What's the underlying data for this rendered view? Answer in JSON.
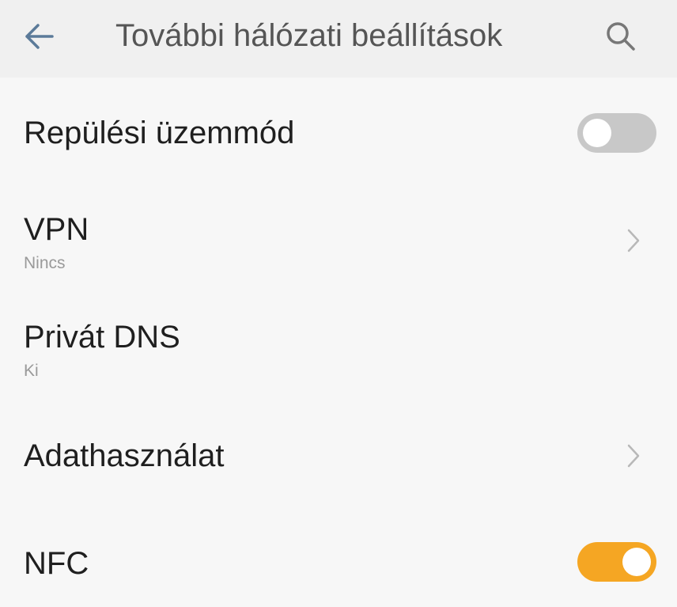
{
  "header": {
    "title": "További hálózati beállítások",
    "back_icon": "arrow-left-icon",
    "search_icon": "search-icon"
  },
  "items": [
    {
      "title": "Repülési üzemmód",
      "type": "toggle",
      "state": "off"
    },
    {
      "title": "VPN",
      "subtitle": "Nincs",
      "type": "link"
    },
    {
      "title": "Privát DNS",
      "subtitle": "Ki",
      "type": "plain"
    },
    {
      "title": "Adathasználat",
      "type": "link"
    },
    {
      "title": "NFC",
      "type": "toggle",
      "state": "on"
    }
  ],
  "colors": {
    "accent": "#f5a623",
    "back_arrow": "#5b7a99",
    "toggle_off": "#c8c8c8"
  }
}
